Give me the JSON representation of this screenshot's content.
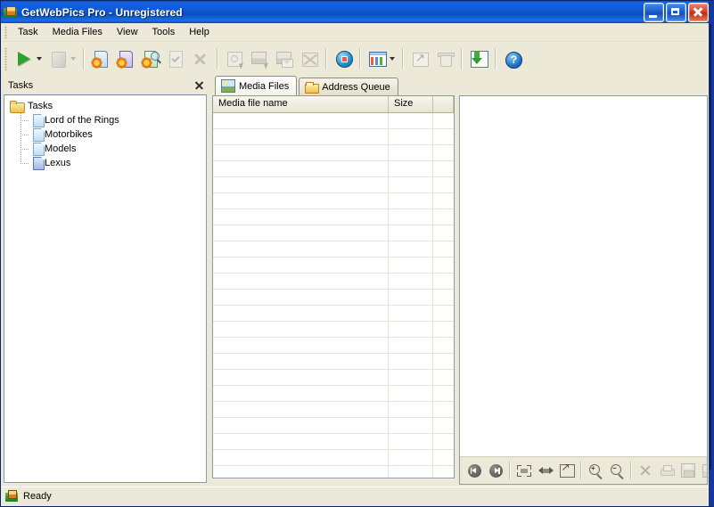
{
  "window": {
    "title_app": "GetWebPics Pro",
    "title_sep": " - ",
    "title_state": "Unregistered",
    "app_icon": "app-folder-picture-icon",
    "buttons": {
      "minimize": "minimize-button",
      "maximize": "maximize-button",
      "close": "close-button"
    }
  },
  "menu": {
    "items": [
      {
        "label": "Task"
      },
      {
        "label": "Media Files"
      },
      {
        "label": "View"
      },
      {
        "label": "Tools"
      },
      {
        "label": "Help"
      }
    ]
  },
  "toolbar": {
    "groups": [
      {
        "buttons": [
          {
            "name": "start-task-button",
            "icon": "green-play-icon",
            "enabled": true,
            "dropdown": true
          },
          {
            "name": "stop-task-button",
            "icon": "stop-square-icon",
            "enabled": false,
            "dropdown": true
          }
        ]
      },
      {
        "buttons": [
          {
            "name": "new-task-button",
            "icon": "blue-document-gear-icon",
            "enabled": true
          },
          {
            "name": "new-task-violet-button",
            "icon": "violet-document-gear-icon",
            "enabled": true
          },
          {
            "name": "task-properties-button",
            "icon": "green-document-gear-search-icon",
            "enabled": true
          },
          {
            "name": "edit-task-button",
            "icon": "checked-document-icon",
            "enabled": false
          },
          {
            "name": "delete-task-button",
            "icon": "x-delete-icon",
            "enabled": false
          }
        ]
      },
      {
        "buttons": [
          {
            "name": "select-all-files-button",
            "icon": "frame-cursor-icon",
            "enabled": false
          },
          {
            "name": "invert-selection-button",
            "icon": "picture-swap-icon",
            "enabled": false
          },
          {
            "name": "send-picture-button",
            "icon": "picture-envelope-icon",
            "enabled": false
          },
          {
            "name": "clear-selection-button",
            "icon": "crossed-box-icon",
            "enabled": false
          }
        ]
      },
      {
        "buttons": [
          {
            "name": "browse-web-button",
            "icon": "globe-icon",
            "enabled": true
          },
          {
            "name": "view-mode-button",
            "icon": "thumbnails-grid-icon",
            "enabled": true,
            "dropdown": true
          }
        ]
      },
      {
        "buttons": [
          {
            "name": "export-button",
            "icon": "export-arrow-icon",
            "enabled": false
          },
          {
            "name": "clear-queue-button",
            "icon": "trash-icon",
            "enabled": false
          }
        ]
      },
      {
        "buttons": [
          {
            "name": "download-button",
            "icon": "green-download-arrow-icon",
            "enabled": true
          }
        ]
      },
      {
        "buttons": [
          {
            "name": "help-button",
            "icon": "blue-question-help-icon",
            "enabled": true,
            "glyph": "?"
          }
        ]
      }
    ]
  },
  "tasks_panel": {
    "title": "Tasks",
    "close_icon": "close-icon",
    "tree": {
      "root": {
        "label": "Tasks",
        "icon": "folder-icon"
      },
      "children": [
        {
          "label": "Lord of the Rings",
          "icon": "page-icon",
          "selected": false
        },
        {
          "label": "Motorbikes",
          "icon": "page-icon",
          "selected": false
        },
        {
          "label": "Models",
          "icon": "page-icon",
          "selected": false
        },
        {
          "label": "Lexus",
          "icon": "page-icon",
          "selected": true
        }
      ]
    }
  },
  "tabs": [
    {
      "label": "Media Files",
      "icon": "media-picture-icon",
      "active": true
    },
    {
      "label": "Address Queue",
      "icon": "folder-icon",
      "active": false
    }
  ],
  "media_list": {
    "columns": [
      {
        "label": "Media file name",
        "key": "name"
      },
      {
        "label": "Size",
        "key": "size"
      },
      {
        "label": "",
        "key": "extra"
      }
    ],
    "rows": [],
    "empty_row_count": 24
  },
  "preview": {
    "toolbar": [
      {
        "name": "previous-image-button",
        "icon": "skip-previous-icon",
        "enabled": true
      },
      {
        "name": "next-image-button",
        "icon": "skip-next-icon",
        "enabled": true
      },
      {
        "name": "fit-to-window-button",
        "icon": "fit-to-window-icon",
        "enabled": true
      },
      {
        "name": "actual-size-button",
        "icon": "actual-size-icon",
        "enabled": true
      },
      {
        "name": "open-external-button",
        "icon": "open-external-icon",
        "enabled": true
      },
      {
        "name": "zoom-in-button",
        "icon": "zoom-in-icon",
        "enabled": true,
        "glyph": "+"
      },
      {
        "name": "zoom-out-button",
        "icon": "zoom-out-icon",
        "enabled": true,
        "glyph": "−"
      },
      {
        "name": "delete-image-button",
        "icon": "x-delete-icon",
        "enabled": false
      },
      {
        "name": "print-image-button",
        "icon": "printer-icon",
        "enabled": false
      },
      {
        "name": "save-image-button",
        "icon": "floppy-save-icon",
        "enabled": false
      },
      {
        "name": "edit-image-button",
        "icon": "edit-picture-icon",
        "enabled": false
      },
      {
        "name": "more-button",
        "icon": "partial-icon",
        "enabled": false
      }
    ]
  },
  "statusbar": {
    "icon": "app-folder-picture-icon",
    "text": "Ready"
  },
  "colors": {
    "titlebar_blue": "#0a52c8",
    "face": "#ece9d8",
    "accent_green": "#2fa12f",
    "border": "#8e9aa8"
  }
}
